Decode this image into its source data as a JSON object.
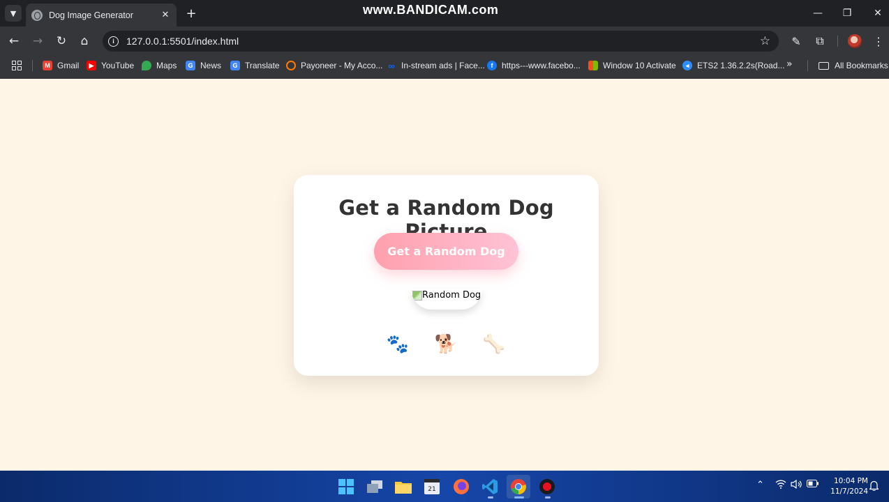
{
  "browser": {
    "tab_title": "Dog Image Generator",
    "new_tab_label": "+",
    "tab_close_label": "✕",
    "watermark": "www.BANDICAM.com",
    "url": "127.0.0.1:5501/index.html",
    "bookmarks": [
      {
        "label": "Gmail",
        "icon": "gmail-icon",
        "color": "#ea4335"
      },
      {
        "label": "YouTube",
        "icon": "youtube-icon",
        "color": "#ff0000"
      },
      {
        "label": "Maps",
        "icon": "maps-icon",
        "color": "#34a853"
      },
      {
        "label": "News",
        "icon": "news-icon",
        "color": "#4285f4"
      },
      {
        "label": "Translate",
        "icon": "translate-icon",
        "color": "#4285f4"
      },
      {
        "label": "Payoneer - My Acco...",
        "icon": "payoneer-icon",
        "color": "#ff7a00"
      },
      {
        "label": "In-stream ads | Face...",
        "icon": "meta-icon",
        "color": "#0866ff"
      },
      {
        "label": "https---www.facebo...",
        "icon": "facebook-icon",
        "color": "#1877f2"
      },
      {
        "label": "Window 10 Activate",
        "icon": "windows-icon",
        "color": "#f25022"
      },
      {
        "label": "ETS2 1.36.2.2s(Road...",
        "icon": "ets2-icon",
        "color": "#2d8cff"
      }
    ],
    "all_bookmarks_label": "All Bookmarks"
  },
  "page": {
    "title": "Get a Random Dog Picture",
    "button_label": "Get a Random Dog",
    "image_alt": "Random Dog",
    "decorations": [
      "🐾",
      "🐕",
      "🦴"
    ]
  },
  "taskbar": {
    "apps": [
      "start-icon",
      "task-view-icon",
      "file-explorer-icon",
      "clipchamp-icon",
      "firefox-icon",
      "vscode-icon",
      "chrome-icon",
      "bandicam-icon"
    ],
    "time": "10:04 PM",
    "date": "11/7/2024"
  },
  "colors": {
    "page_bg": "#fff5e6",
    "button_gradient_start": "#ffa0ad",
    "button_gradient_end": "#ffc2d6",
    "title_color": "#333333"
  }
}
